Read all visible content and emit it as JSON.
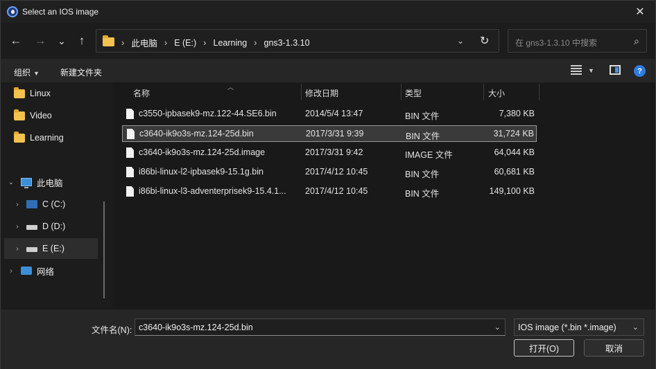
{
  "window": {
    "title": "Select an IOS image",
    "close_glyph": "✕"
  },
  "nav": {
    "back": "←",
    "forward": "→",
    "recent": "⌄",
    "up": "↑",
    "breadcrumbs": [
      "此电脑",
      "E (E:)",
      "Learning",
      "gns3-1.3.10"
    ],
    "search_placeholder": "在 gns3-1.3.10 中搜索"
  },
  "commands": {
    "organize": "组织",
    "new_folder": "新建文件夹"
  },
  "sidebar": {
    "items": [
      {
        "label": "Linux",
        "icon": "folder-icon"
      },
      {
        "label": "Video",
        "icon": "folder-icon"
      },
      {
        "label": "Learning",
        "icon": "folder-icon"
      },
      {
        "label": "此电脑",
        "icon": "pc-icon"
      },
      {
        "label": "C (C:)",
        "icon": "drive-icon"
      },
      {
        "label": "D (D:)",
        "icon": "drive-icon"
      },
      {
        "label": "E (E:)",
        "icon": "drive-icon",
        "selected": true
      },
      {
        "label": "网络",
        "icon": "network-icon"
      }
    ]
  },
  "columns": {
    "name": "名称",
    "modified": "修改日期",
    "type": "类型",
    "size": "大小"
  },
  "files": [
    {
      "name": "c3550-ipbasek9-mz.122-44.SE6.bin",
      "modified": "2014/5/4 13:47",
      "type": "BIN 文件",
      "size": "7,380 KB"
    },
    {
      "name": "c3640-ik9o3s-mz.124-25d.bin",
      "modified": "2017/3/31 9:39",
      "type": "BIN 文件",
      "size": "31,724 KB",
      "selected": true
    },
    {
      "name": "c3640-ik9o3s-mz.124-25d.image",
      "modified": "2017/3/31 9:42",
      "type": "IMAGE 文件",
      "size": "64,044 KB"
    },
    {
      "name": "i86bi-linux-l2-ipbasek9-15.1g.bin",
      "modified": "2017/4/12 10:45",
      "type": "BIN 文件",
      "size": "60,681 KB"
    },
    {
      "name": "i86bi-linux-l3-adventerprisek9-15.4.1...",
      "modified": "2017/4/12 10:45",
      "type": "BIN 文件",
      "size": "149,100 KB"
    }
  ],
  "footer": {
    "filename_label": "文件名(N):",
    "filename_value": "c3640-ik9o3s-mz.124-25d.bin",
    "filter_value": "IOS image (*.bin *.image)",
    "open_label": "打开(O)",
    "cancel_label": "取消"
  }
}
